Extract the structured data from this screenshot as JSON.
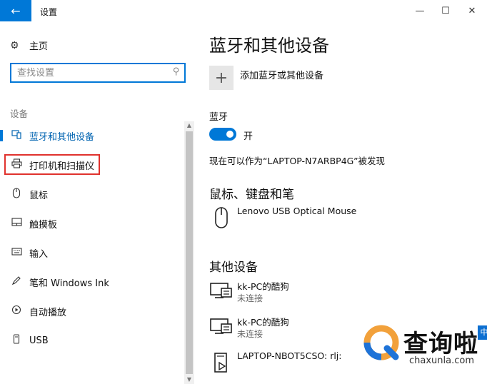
{
  "window": {
    "title": "设置",
    "back_icon": "back-arrow-icon",
    "minimize_glyph": "—",
    "maximize_glyph": "☐",
    "close_glyph": "✕"
  },
  "sidebar": {
    "home_label": "主页",
    "search_placeholder": "查找设置",
    "section_heading": "设备",
    "items": [
      {
        "label": "蓝牙和其他设备",
        "icon": "bluetooth-devices-icon",
        "active": true
      },
      {
        "label": "打印机和扫描仪",
        "icon": "printer-icon",
        "active": false,
        "highlighted": true
      },
      {
        "label": "鼠标",
        "icon": "mouse-icon",
        "active": false
      },
      {
        "label": "触摸板",
        "icon": "touchpad-icon",
        "active": false
      },
      {
        "label": "输入",
        "icon": "keyboard-icon",
        "active": false
      },
      {
        "label": "笔和 Windows Ink",
        "icon": "pen-icon",
        "active": false
      },
      {
        "label": "自动播放",
        "icon": "autoplay-icon",
        "active": false
      },
      {
        "label": "USB",
        "icon": "usb-icon",
        "active": false
      }
    ]
  },
  "main": {
    "title": "蓝牙和其他设备",
    "add_device_label": "添加蓝牙或其他设备",
    "bluetooth_label": "蓝牙",
    "bluetooth_state": "开",
    "bluetooth_on": true,
    "discoverable_text": "现在可以作为“LAPTOP-N7ARBP4G”被发现",
    "mouse_section_title": "鼠标、键盘和笔",
    "mouse_devices": [
      {
        "name": "Lenovo USB Optical Mouse",
        "icon": "mouse-icon"
      }
    ],
    "other_section_title": "其他设备",
    "other_devices": [
      {
        "name": "kk-PC的酷狗",
        "status": "未连接",
        "icon": "media-device-icon"
      },
      {
        "name": "kk-PC的酷狗",
        "status": "未连接",
        "icon": "media-device-icon"
      },
      {
        "name": "LAPTOP-NBOT5CSO: rlj:",
        "status": "",
        "icon": "media-player-device-icon"
      }
    ]
  },
  "watermark": {
    "text": "查询啦",
    "url": "chaxunla.com",
    "tag": "中"
  },
  "colors": {
    "accent": "#0078d7",
    "active_text": "#0063b1",
    "highlight_border": "#e0322d",
    "logo_orange": "#f2a13b",
    "logo_blue": "#1e73d8"
  }
}
